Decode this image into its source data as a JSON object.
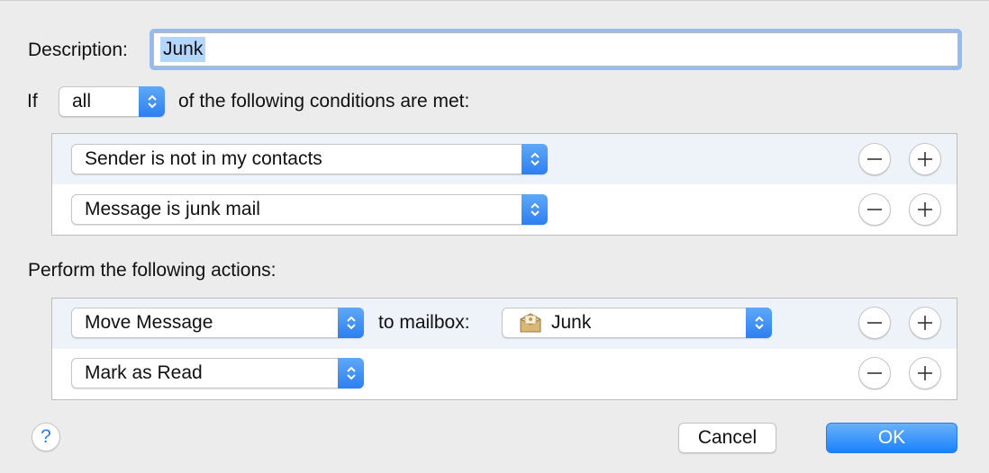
{
  "description": {
    "label": "Description:",
    "value": "Junk"
  },
  "conditions_header": {
    "if_label": "If",
    "match_value": "all",
    "suffix": "of the following conditions are met:"
  },
  "conditions": [
    {
      "criterion": "Sender is not in my contacts"
    },
    {
      "criterion": "Message is junk mail"
    }
  ],
  "actions_header": "Perform the following actions:",
  "actions": [
    {
      "action": "Move Message",
      "target_label": "to mailbox:",
      "mailbox": "Junk",
      "mailbox_icon": "junk-mailbox-icon"
    },
    {
      "action": "Mark as Read"
    }
  ],
  "buttons": {
    "help": "?",
    "cancel": "Cancel",
    "ok": "OK"
  },
  "colors": {
    "accent": "#2d7ff2",
    "focus_ring": "#93bdf0",
    "selection": "#b4d5fe"
  }
}
